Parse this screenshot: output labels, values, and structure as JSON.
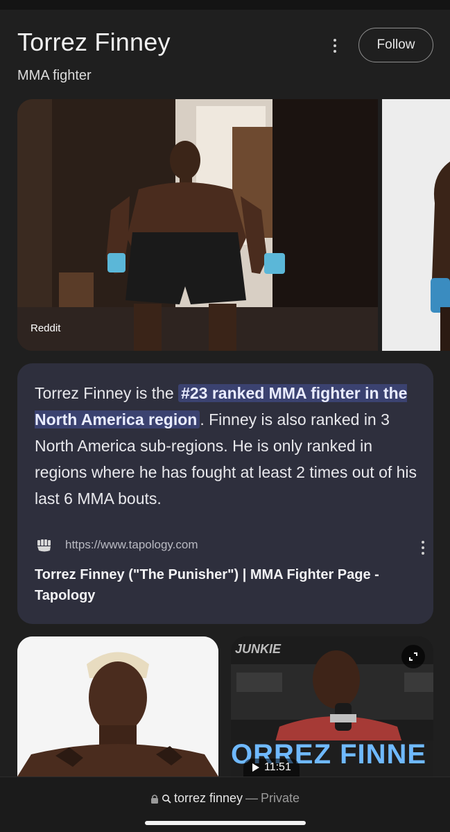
{
  "header": {
    "title": "Torrez Finney",
    "subtitle": "MMA fighter",
    "follow_label": "Follow"
  },
  "images": {
    "main_source_label": "Reddit"
  },
  "snippet": {
    "text_before": "Torrez Finney is the ",
    "highlight": "#23 ranked MMA fighter in the North America region",
    "text_after": ". Finney is also ranked in 3 North America sub-regions. He is only ranked in regions where he has fought at least 2 times out of his last 6 MMA bouts.",
    "source_url": "https://www.tapology.com",
    "source_title": "Torrez Finney (\"The Punisher\") | MMA Fighter Page - Tapology"
  },
  "video": {
    "overlay_brand": "JUNKIE",
    "overlay_banner": "ORREZ FINNE",
    "duration": "11:51"
  },
  "browser": {
    "query": "torrez finney",
    "separator": "—",
    "mode": "Private"
  },
  "icons": {
    "more": "more-vert-icon",
    "lock": "lock-icon",
    "search": "search-icon",
    "play": "play-icon",
    "expand": "expand-icon",
    "favicon": "tapology-favicon-icon"
  },
  "colors": {
    "background": "#1f1f1f",
    "card": "#2e2f3d",
    "highlight": "#3b4270"
  }
}
